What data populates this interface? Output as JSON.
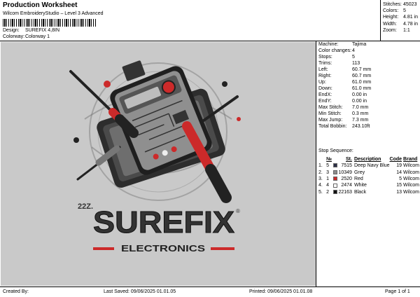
{
  "header": {
    "title": "Production Worksheet",
    "subtitle": "Wilcom EmbroideryStudio – Level 3 Advanced",
    "design_label": "Design:",
    "design_value": "SUREFIX 4,8IN",
    "colorway_label": "Colorway:",
    "colorway_value": "Colorway 1"
  },
  "stats": [
    {
      "label": "Stitches:",
      "value": "45023"
    },
    {
      "label": "Colors:",
      "value": "5"
    },
    {
      "label": "Height:",
      "value": "4.81 in"
    },
    {
      "label": "Width:",
      "value": "4.78 in"
    },
    {
      "label": "Zoom:",
      "value": "1:1"
    }
  ],
  "params": [
    {
      "label": "Machine:",
      "value": "Tajima"
    },
    {
      "label": "Color changes:",
      "value": "4"
    },
    {
      "label": "Stops:",
      "value": "5"
    },
    {
      "label": "Trims:",
      "value": "113"
    },
    {
      "label": "Left:",
      "value": "60.7 mm"
    },
    {
      "label": "Right:",
      "value": "60.7 mm"
    },
    {
      "label": "Up:",
      "value": "61.0 mm"
    },
    {
      "label": "Down:",
      "value": "61.0 mm"
    },
    {
      "label": "EndX:",
      "value": "0.00 in"
    },
    {
      "label": "EndY:",
      "value": "0.00 in"
    },
    {
      "label": "Max Stitch:",
      "value": "7.0 mm"
    },
    {
      "label": "Min Stitch:",
      "value": "0.3 mm"
    },
    {
      "label": "Max Jump:",
      "value": "7.3 mm"
    },
    {
      "label": "Total Bobbin:",
      "value": "243.10ft"
    }
  ],
  "stop_sequence": {
    "title": "Stop Sequence:",
    "headers": {
      "num": "№",
      "st": "St.",
      "desc": "Description",
      "code": "Code",
      "brand": "Brand"
    },
    "rows": [
      {
        "idx": "1.",
        "num": "5",
        "color": "#2b2f45",
        "st": "7515",
        "desc": "Deep Navy Blue",
        "code": "19",
        "brand": "Wilcom"
      },
      {
        "idx": "2.",
        "num": "3",
        "color": "#8c8c8c",
        "st": "10349",
        "desc": "Grey",
        "code": "14",
        "brand": "Wilcom"
      },
      {
        "idx": "3.",
        "num": "1",
        "color": "#cc2a2a",
        "st": "2520",
        "desc": "Red",
        "code": "5",
        "brand": "Wilcom"
      },
      {
        "idx": "4.",
        "num": "4",
        "color": "#ffffff",
        "st": "2474",
        "desc": "White",
        "code": "15",
        "brand": "Wilcom"
      },
      {
        "idx": "5.",
        "num": "2",
        "color": "#111111",
        "st": "22163",
        "desc": "Black",
        "code": "13",
        "brand": "Wilcom"
      }
    ]
  },
  "design": {
    "small_text": "22Z.",
    "brand_name": "SUREFIX",
    "trademark": "®",
    "tagline": "ELECTRONICS"
  },
  "footer": {
    "created_by": "Created By:",
    "last_saved": "Last Saved: 09/06/2025 01.01.05",
    "printed": "Printed: 09/06/2025 01.01.08",
    "page": "Page 1 of 1"
  }
}
